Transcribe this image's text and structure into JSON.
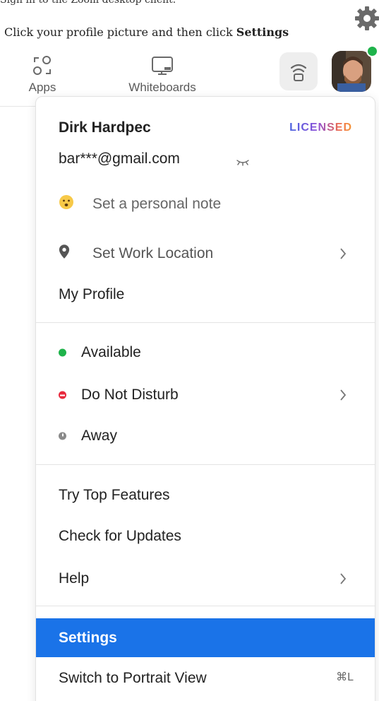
{
  "instruction": {
    "prefix": "Click your profile picture and then click ",
    "emphasis": "Settings"
  },
  "top_clip_text": "Sign in to the Zoom desktop client.",
  "toolbar": {
    "apps_label": "Apps",
    "whiteboards_label": "Whiteboards"
  },
  "menu": {
    "user_name": "Dirk Hardpec",
    "license_badge": "LICENSED",
    "email": "bar***@gmail.com",
    "personal_note": "Set a personal note",
    "work_location": "Set Work Location",
    "my_profile": "My Profile",
    "status": {
      "available": "Available",
      "do_not_disturb": "Do Not Disturb",
      "away": "Away"
    },
    "try_top_features": "Try Top Features",
    "check_for_updates": "Check for Updates",
    "help": "Help",
    "settings": "Settings",
    "switch_portrait": "Switch to Portrait View",
    "switch_portrait_shortcut": "⌘L"
  },
  "colors": {
    "selection": "#1a73e8",
    "available": "#1fb34b",
    "do_not_disturb": "#e8283c",
    "away": "#8a8a8a"
  }
}
